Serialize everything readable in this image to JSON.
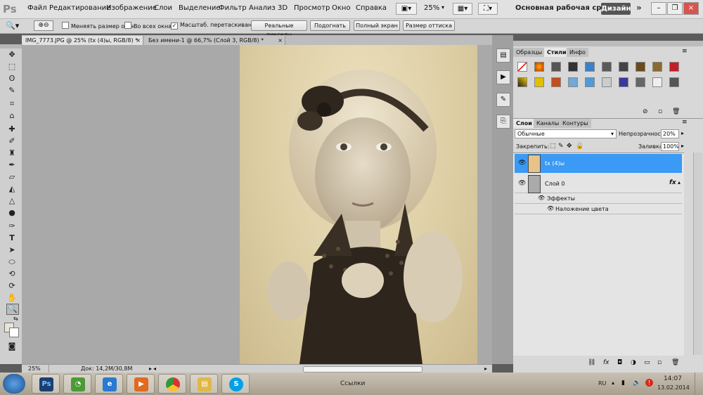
{
  "app": {
    "logo": "Ps"
  },
  "menu": [
    "Файл",
    "Редактирование",
    "Изображение",
    "Слои",
    "Выделение",
    "Фильтр",
    "Анализ",
    "3D",
    "Просмотр",
    "Окно",
    "Справка"
  ],
  "menubar": {
    "zoom": "25%",
    "workspace": "Основная рабочая среда",
    "design": "Дизайн",
    "more": "»"
  },
  "options": {
    "resize_windows": "Меняять размер окон",
    "all_windows": "Во всех окнах",
    "scrubby_zoom": "Масштаб. перетаскиванием",
    "actual_pixels": "Реальные пикселы",
    "fit_screen": "Подогнать",
    "fill_screen": "Полный экран",
    "print_size": "Размер оттиска"
  },
  "doc_tabs": [
    {
      "label": "IMG_7773.JPG @ 25% (tx (4)ы, RGB/8) *",
      "close": "×"
    },
    {
      "label": "Без имени-1 @ 66,7% (Слой 3, RGB/8) *",
      "close": "×"
    }
  ],
  "status": {
    "zoom": "25%",
    "doc": "Док: 14,2M/30,8M"
  },
  "styles_panel": {
    "tabs": [
      "Образцы",
      "Стили",
      "Инфо"
    ]
  },
  "layers_panel": {
    "tabs": [
      "Слои",
      "Каналы",
      "Контуры"
    ],
    "blend_mode": "Обычные",
    "opacity_label": "Непрозрачность:",
    "opacity_value": "20%",
    "lock_label": "Закрепить:",
    "fill_label": "Заливка:",
    "fill_value": "100%",
    "layers": [
      {
        "name": "tx (4)ы"
      },
      {
        "name": "Слой 0",
        "fx": "fx"
      }
    ],
    "effects_label": "Эффекты",
    "effect_item": "Наложение цвета"
  },
  "taskbar": {
    "links": "Ссылки",
    "lang": "RU",
    "time": "14:07",
    "date": "13.02.2014"
  },
  "colors": {
    "accent": "#3399ff",
    "selected_layer": "#3a9af5",
    "photo_sepia": "#d8c89c"
  }
}
